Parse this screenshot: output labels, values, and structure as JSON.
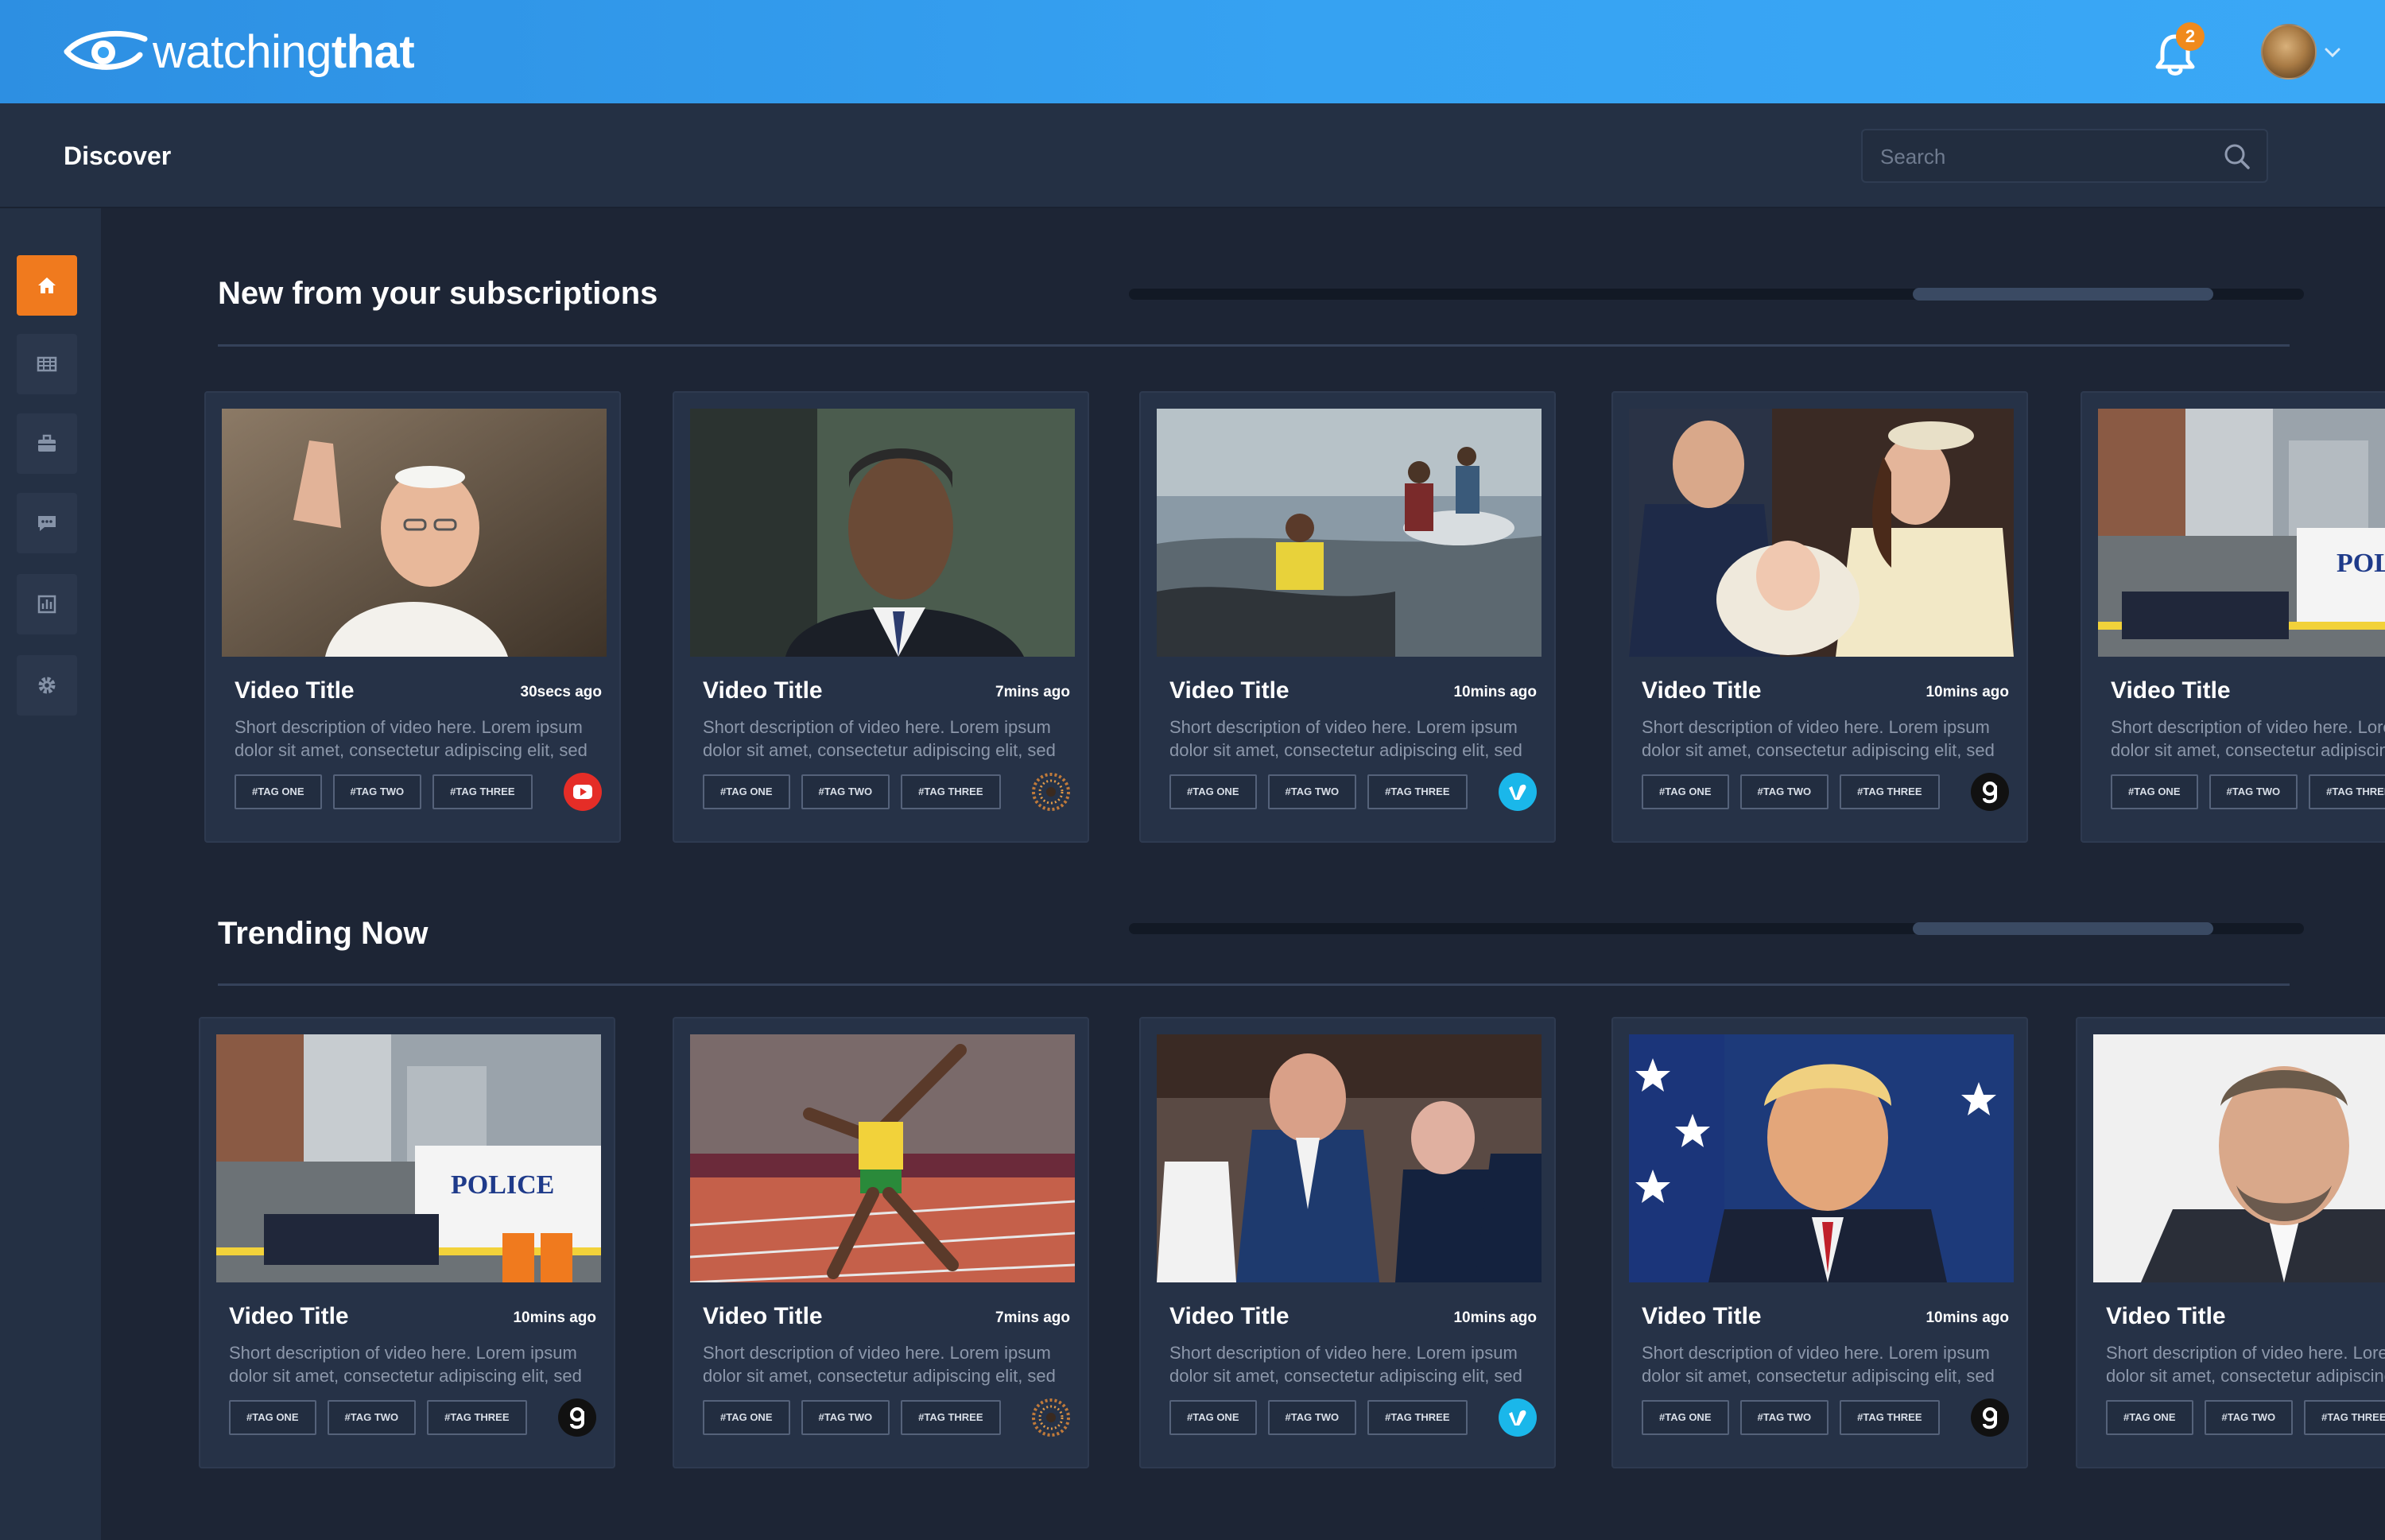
{
  "brand": {
    "name_light": "watching",
    "name_bold": "that"
  },
  "header": {
    "notification_count": "2"
  },
  "subheader": {
    "title": "Discover",
    "search_placeholder": "Search"
  },
  "sidebar": {
    "items": [
      {
        "icon": "home-icon",
        "active": true
      },
      {
        "icon": "grid-icon",
        "active": false
      },
      {
        "icon": "briefcase-icon",
        "active": false
      },
      {
        "icon": "chat-icon",
        "active": false
      },
      {
        "icon": "bar-chart-icon",
        "active": false
      },
      {
        "icon": "gear-icon",
        "active": false
      }
    ]
  },
  "sections": [
    {
      "title": "New from your subscriptions",
      "cards": [
        {
          "title": "Video Title",
          "time": "30secs ago",
          "desc": "Short description of video here. Lorem ipsum dolor sit amet, consectetur adipiscing elit, sed",
          "tags": [
            "#TAG ONE",
            "#TAG TWO",
            "#TAG THREE"
          ],
          "source": "youtube"
        },
        {
          "title": "Video Title",
          "time": "7mins ago",
          "desc": "Short description of video here. Lorem ipsum dolor sit amet, consectetur adipiscing elit, sed",
          "tags": [
            "#TAG ONE",
            "#TAG TWO",
            "#TAG THREE"
          ],
          "source": "swirl"
        },
        {
          "title": "Video Title",
          "time": "10mins ago",
          "desc": "Short description of video here. Lorem ipsum dolor sit amet, consectetur adipiscing elit, sed",
          "tags": [
            "#TAG ONE",
            "#TAG TWO",
            "#TAG THREE"
          ],
          "source": "vimeo"
        },
        {
          "title": "Video Title",
          "time": "10mins ago",
          "desc": "Short description of video here. Lorem ipsum dolor sit amet, consectetur adipiscing elit, sed",
          "tags": [
            "#TAG ONE",
            "#TAG TWO",
            "#TAG THREE"
          ],
          "source": "getty"
        },
        {
          "title": "Video Title",
          "time": "",
          "desc": "Short description of video here. Lorem ipsum dolor sit amet, consectetur adipiscing elit, sed",
          "tags": [
            "#TAG ONE",
            "#TAG TWO",
            "#TAG THREE"
          ],
          "source": ""
        }
      ]
    },
    {
      "title": "Trending Now",
      "cards": [
        {
          "title": "Video Title",
          "time": "10mins ago",
          "desc": "Short description of video here. Lorem ipsum dolor sit amet, consectetur adipiscing elit, sed",
          "tags": [
            "#TAG ONE",
            "#TAG TWO",
            "#TAG THREE"
          ],
          "source": "getty"
        },
        {
          "title": "Video Title",
          "time": "7mins ago",
          "desc": "Short description of video here. Lorem ipsum dolor sit amet, consectetur adipiscing elit, sed",
          "tags": [
            "#TAG ONE",
            "#TAG TWO",
            "#TAG THREE"
          ],
          "source": "swirl"
        },
        {
          "title": "Video Title",
          "time": "10mins ago",
          "desc": "Short description of video here. Lorem ipsum dolor sit amet, consectetur adipiscing elit, sed",
          "tags": [
            "#TAG ONE",
            "#TAG TWO",
            "#TAG THREE"
          ],
          "source": "vimeo"
        },
        {
          "title": "Video Title",
          "time": "10mins ago",
          "desc": "Short description of video here. Lorem ipsum dolor sit amet, consectetur adipiscing elit, sed",
          "tags": [
            "#TAG ONE",
            "#TAG TWO",
            "#TAG THREE"
          ],
          "source": "getty"
        },
        {
          "title": "Video Title",
          "time": "",
          "desc": "Short description of video here. Lorem ipsum dolor sit amet, consectetur adipiscing elit, sed",
          "tags": [
            "#TAG ONE",
            "#TAG TWO",
            "#TAG THREE"
          ],
          "source": ""
        }
      ]
    }
  ],
  "colors": {
    "accent": "#f07a1e",
    "header_blue": "#36a2f2",
    "background": "#1d2535",
    "panel": "#243044",
    "card": "#263247",
    "vimeo": "#1ab7ea",
    "youtube": "#e52d27"
  }
}
